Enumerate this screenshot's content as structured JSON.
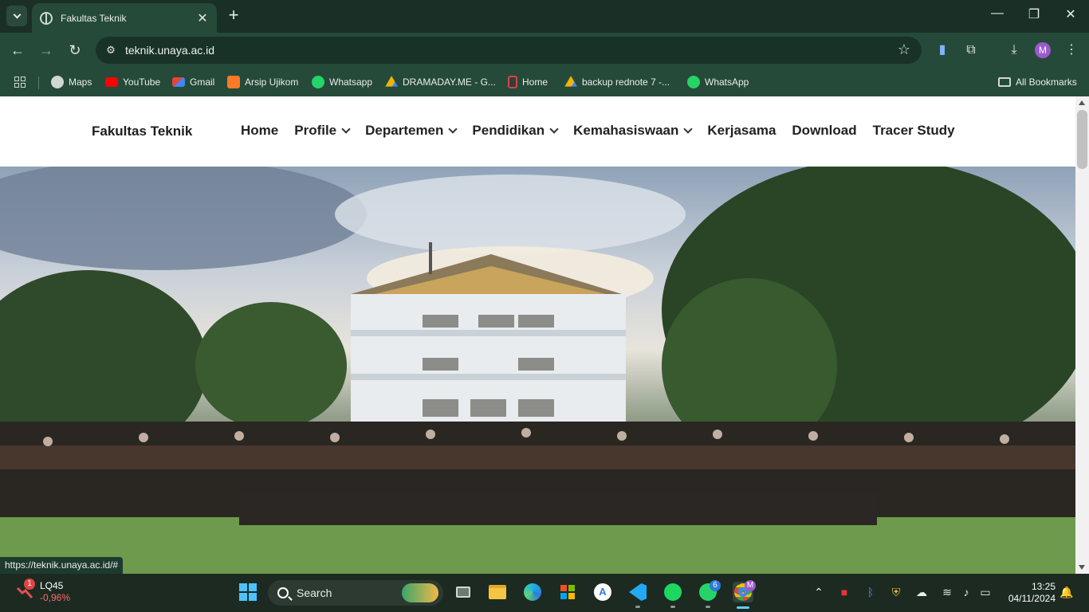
{
  "browser": {
    "tab_title": "Fakultas Teknik",
    "new_tab": "+",
    "url": "teknik.unaya.ac.id",
    "status_url": "https://teknik.unaya.ac.id/#",
    "profile_initial": "M",
    "bookmarks": [
      {
        "label": "Maps",
        "icon": "maps-icon"
      },
      {
        "label": "YouTube",
        "icon": "youtube-icon"
      },
      {
        "label": "Gmail",
        "icon": "gmail-icon"
      },
      {
        "label": "Arsip Ujikom",
        "icon": "xampp-icon"
      },
      {
        "label": "Whatsapp",
        "icon": "whatsapp-icon"
      },
      {
        "label": "DRAMADAY.ME - G...",
        "icon": "google-drive-icon"
      },
      {
        "label": "Home",
        "icon": "app-icon"
      },
      {
        "label": "backup rednote 7 -...",
        "icon": "google-drive-icon"
      },
      {
        "label": "WhatsApp",
        "icon": "whatsapp-icon"
      }
    ],
    "all_bookmarks": "All Bookmarks"
  },
  "site": {
    "brand": "Fakultas Teknik",
    "nav": [
      {
        "label": "Home",
        "dropdown": false
      },
      {
        "label": "Profile",
        "dropdown": true
      },
      {
        "label": "Departemen",
        "dropdown": true
      },
      {
        "label": "Pendidikan",
        "dropdown": true
      },
      {
        "label": "Kemahasiswaan",
        "dropdown": true
      },
      {
        "label": "Kerjasama",
        "dropdown": false
      },
      {
        "label": "Download",
        "dropdown": false
      },
      {
        "label": "Tracer Study",
        "dropdown": false
      }
    ]
  },
  "taskbar": {
    "stock_badge": "1",
    "stock_symbol": "LQ45",
    "stock_change": "-0,96%",
    "search_label": "Search",
    "whatsapp_badge": "6",
    "chrome_profile": "M",
    "time": "13:25",
    "date": "04/11/2024"
  },
  "colors": {
    "chrome_bg": "#264a3a",
    "tabstrip_bg": "#1a2f25",
    "taskbar_bg": "#1c2a22",
    "profile": "#9b59d0",
    "stock_down": "#ff6b6b"
  }
}
